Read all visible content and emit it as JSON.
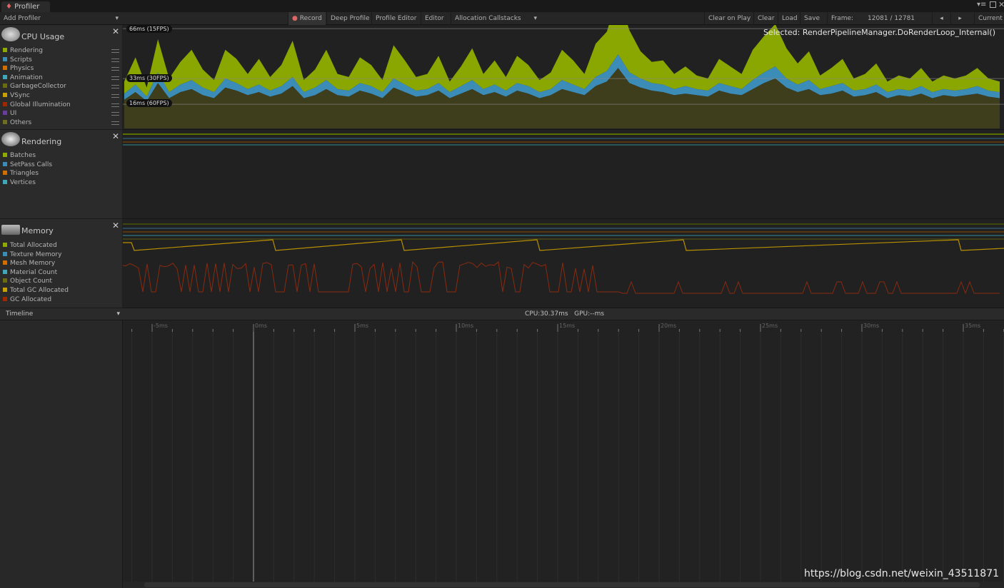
{
  "window": {
    "tab_title": "Profiler"
  },
  "toolbar": {
    "add_profiler": "Add Profiler",
    "record": "Record",
    "deep_profile": "Deep Profile",
    "profile_editor": "Profile Editor",
    "target": "Editor",
    "allocation_callstacks": "Allocation Callstacks",
    "clear_on_play": "Clear on Play",
    "clear": "Clear",
    "load": "Load",
    "save": "Save",
    "frame_label": "Frame:",
    "frame_value": "12081 / 12781",
    "current": "Current"
  },
  "cpu": {
    "title": "CPU Usage",
    "selected": "Selected: RenderPipelineManager.DoRenderLoop_Internal()",
    "fps_lines": [
      "66ms (15FPS)",
      "33ms (30FPS)",
      "16ms (60FPS)"
    ],
    "legend": [
      {
        "label": "Rendering",
        "color": "#8fa900"
      },
      {
        "label": "Scripts",
        "color": "#3c8cb8"
      },
      {
        "label": "Physics",
        "color": "#d26e00"
      },
      {
        "label": "Animation",
        "color": "#3fa8b8"
      },
      {
        "label": "GarbageCollector",
        "color": "#6b6b10"
      },
      {
        "label": "VSync",
        "color": "#c8a000"
      },
      {
        "label": "Global Illumination",
        "color": "#a02800"
      },
      {
        "label": "UI",
        "color": "#6a3ca0"
      },
      {
        "label": "Others",
        "color": "#6e6e20"
      }
    ],
    "frame_ms_others": [
      19,
      24,
      18,
      30,
      20,
      24,
      26,
      22,
      20,
      27,
      25,
      22,
      24,
      21,
      23,
      28,
      20,
      22,
      26,
      22,
      21,
      25,
      23,
      20,
      27,
      24,
      21,
      22,
      25,
      20,
      23,
      26,
      22,
      24,
      21,
      25,
      23,
      20,
      22,
      26,
      24,
      22,
      28,
      31,
      40,
      30,
      27,
      25,
      24,
      22,
      23,
      22,
      21,
      25,
      23,
      22,
      26,
      30,
      33,
      27,
      24,
      26,
      22,
      23,
      25,
      21,
      22,
      24,
      20,
      22,
      21,
      23,
      20,
      22,
      21,
      22,
      23,
      21,
      20
    ],
    "frame_ms_scripts": [
      4,
      5,
      3,
      7,
      4,
      5,
      6,
      5,
      4,
      6,
      5,
      4,
      5,
      4,
      5,
      6,
      4,
      5,
      6,
      4,
      4,
      5,
      5,
      4,
      6,
      5,
      4,
      4,
      5,
      4,
      5,
      6,
      4,
      5,
      4,
      5,
      5,
      4,
      4,
      6,
      5,
      4,
      6,
      7,
      9,
      7,
      6,
      5,
      5,
      4,
      5,
      4,
      4,
      5,
      5,
      4,
      6,
      7,
      8,
      6,
      5,
      6,
      4,
      5,
      5,
      4,
      4,
      5,
      4,
      4,
      4,
      5,
      4,
      4,
      4,
      4,
      5,
      4,
      4
    ],
    "frame_ms_rendering": [
      8,
      18,
      6,
      22,
      9,
      15,
      20,
      12,
      8,
      19,
      16,
      10,
      17,
      9,
      14,
      24,
      8,
      12,
      20,
      10,
      9,
      17,
      14,
      8,
      22,
      16,
      9,
      10,
      18,
      7,
      13,
      21,
      10,
      16,
      9,
      18,
      14,
      8,
      11,
      20,
      16,
      10,
      22,
      26,
      40,
      28,
      18,
      14,
      16,
      10,
      13,
      9,
      8,
      16,
      13,
      10,
      20,
      24,
      28,
      20,
      14,
      19,
      9,
      12,
      16,
      8,
      10,
      14,
      7,
      9,
      8,
      12,
      7,
      9,
      8,
      9,
      12,
      8,
      7
    ]
  },
  "rendering": {
    "title": "Rendering",
    "legend": [
      {
        "label": "Batches",
        "color": "#8fa900"
      },
      {
        "label": "SetPass Calls",
        "color": "#3c8cb8"
      },
      {
        "label": "Triangles",
        "color": "#d26e00"
      },
      {
        "label": "Vertices",
        "color": "#3fa8b8"
      }
    ]
  },
  "memory": {
    "title": "Memory",
    "legend": [
      {
        "label": "Total Allocated",
        "color": "#8fa900"
      },
      {
        "label": "Texture Memory",
        "color": "#3c8cb8"
      },
      {
        "label": "Mesh Memory",
        "color": "#d26e00"
      },
      {
        "label": "Material Count",
        "color": "#3fa8b8"
      },
      {
        "label": "Object Count",
        "color": "#6b6b10"
      },
      {
        "label": "Total GC Allocated",
        "color": "#c8a000"
      },
      {
        "label": "GC Allocated",
        "color": "#a02800"
      }
    ]
  },
  "timeline": {
    "mode": "Timeline",
    "cpu_gpu": "CPU:30.37ms   GPU:--ms",
    "ticks": [
      "-5ms",
      "0ms",
      "5ms",
      "10ms",
      "15ms",
      "20ms",
      "25ms",
      "30ms",
      "35ms"
    ]
  },
  "watermark": "https://blog.csdn.net/weixin_43511871"
}
